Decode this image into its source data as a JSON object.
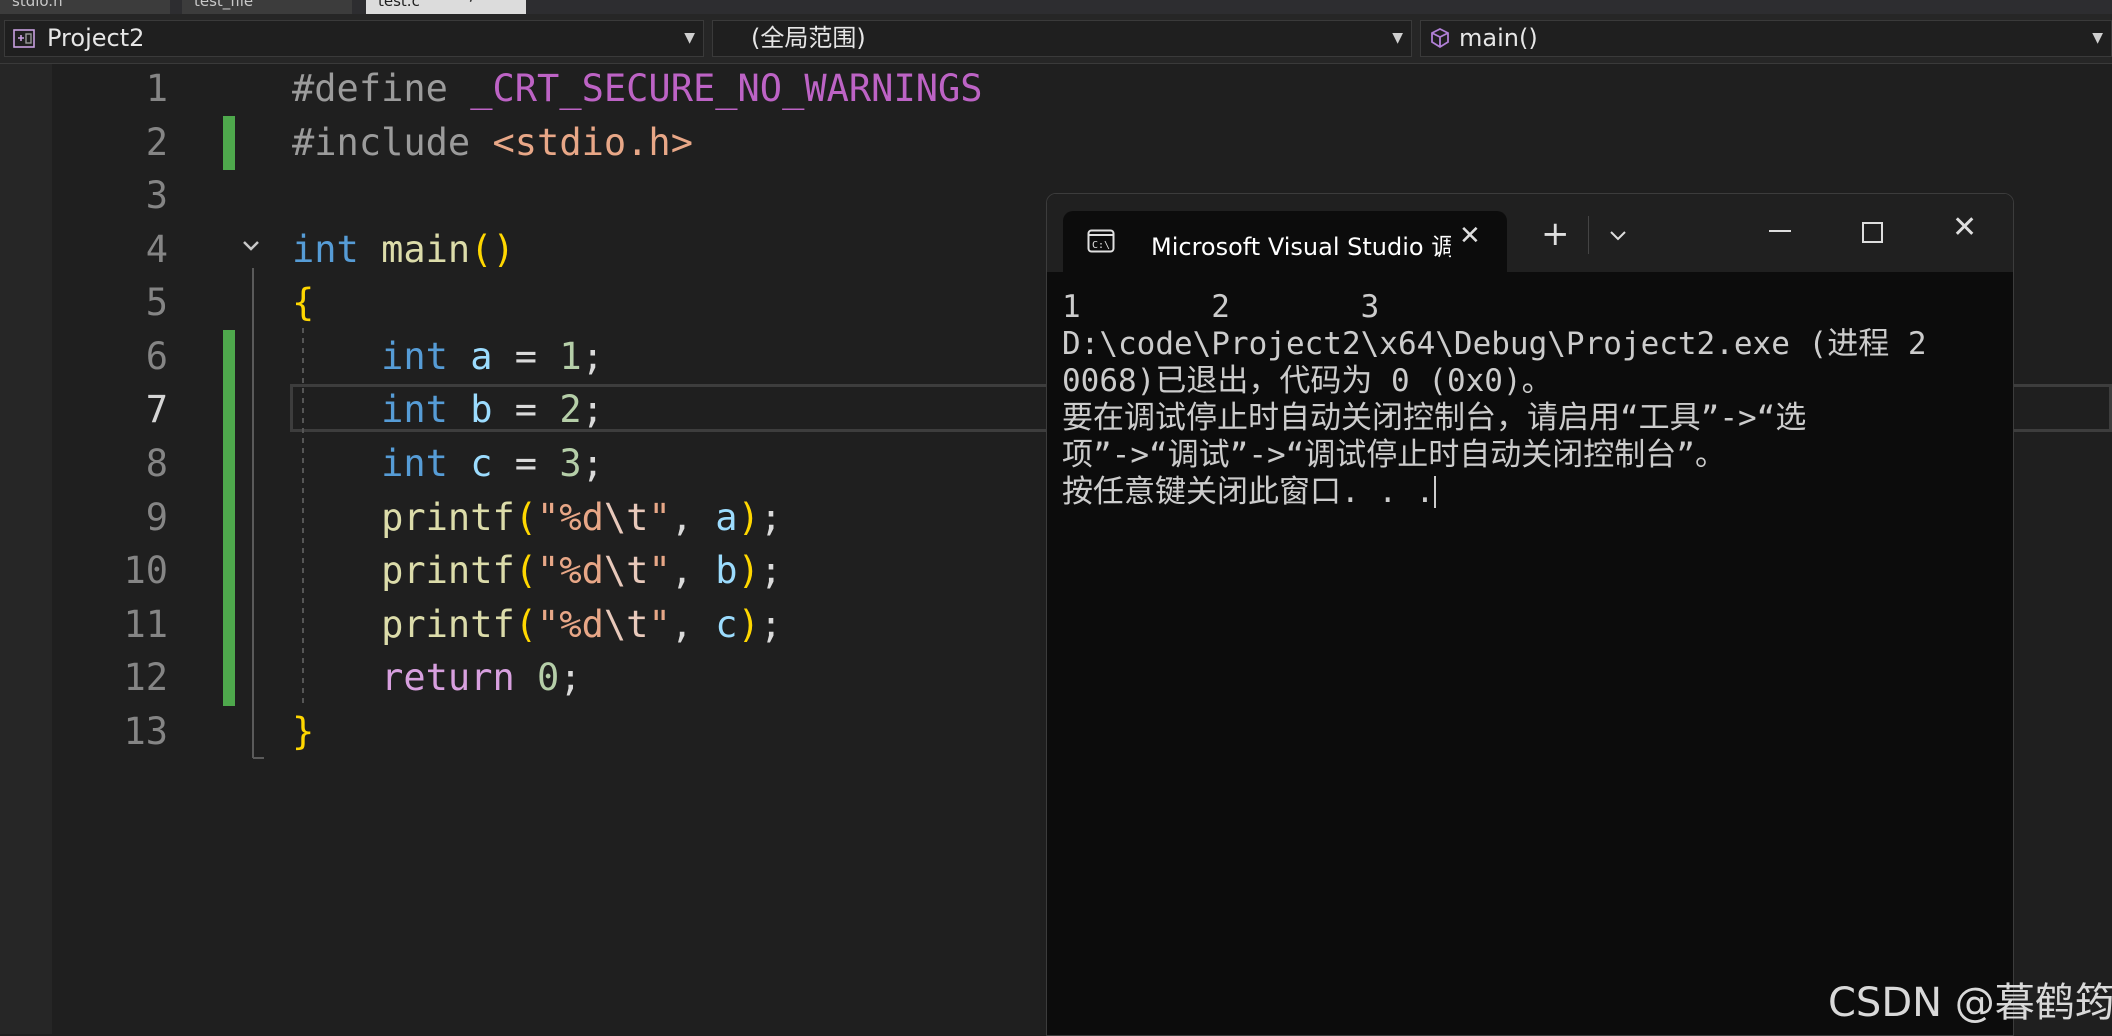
{
  "tabs": [
    {
      "label": "stdio.h",
      "active": false
    },
    {
      "label": "test_file",
      "active": false
    },
    {
      "label": "test.c",
      "active": true
    }
  ],
  "nav": {
    "project": "Project2",
    "scope": "(全局范围)",
    "member": "main()"
  },
  "editor": {
    "line_numbers": [
      "1",
      "2",
      "3",
      "4",
      "5",
      "6",
      "7",
      "8",
      "9",
      "10",
      "11",
      "12",
      "13"
    ],
    "current_line": 7,
    "lines": {
      "l1_directive": "#define",
      "l1_macro": "_CRT_SECURE_NO_WARNINGS",
      "l2_directive": "#include",
      "l2_header": "<stdio.h>",
      "l4_type": "int",
      "l4_name": "main",
      "l4_parens": "()",
      "l5_brace": "{",
      "l6_type": "int",
      "l6_var": "a",
      "l6_eq": "=",
      "l6_num": "1",
      "l6_semi": ";",
      "l7_type": "int",
      "l7_var": "b",
      "l7_eq": "=",
      "l7_num": "2",
      "l7_semi": ";",
      "l8_type": "int",
      "l8_var": "c",
      "l8_eq": "=",
      "l8_num": "3",
      "l8_semi": ";",
      "l9_fn": "printf",
      "l9_str1": "\"%d",
      "l9_esc": "\\t",
      "l9_str2": "\"",
      "l9_arg": "a",
      "l10_fn": "printf",
      "l10_str1": "\"%d",
      "l10_esc": "\\t",
      "l10_str2": "\"",
      "l10_arg": "b",
      "l11_fn": "printf",
      "l11_str1": "\"%d",
      "l11_esc": "\\t",
      "l11_str2": "\"",
      "l11_arg": "c",
      "l12_kw": "return",
      "l12_num": "0",
      "l12_semi": ";",
      "l13_brace": "}"
    }
  },
  "console": {
    "tab_title": "Microsoft Visual Studio 调试控制台",
    "output_lines": [
      "1       2       3",
      "D:\\code\\Project2\\x64\\Debug\\Project2.exe (进程 2",
      "0068)已退出，代码为 0 (0x0)。",
      "要在调试停止时自动关闭控制台，请启用“工具”->“选",
      "项”->“调试”->“调试停止时自动关闭控制台”。",
      "按任意键关闭此窗口. . ."
    ]
  },
  "watermark": "CSDN @暮鹤筠",
  "colors": {
    "accent_change": "#4ea84c",
    "keyword": "#569cd6",
    "string": "#e8a787"
  }
}
